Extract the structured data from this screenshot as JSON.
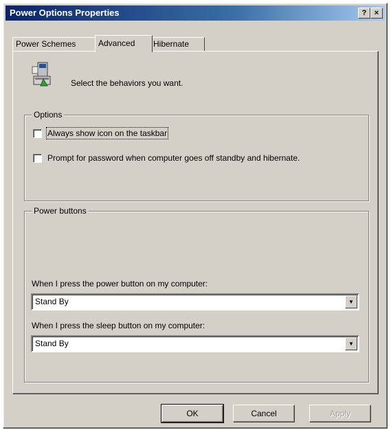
{
  "window": {
    "title": "Power Options Properties",
    "help_button": "?",
    "close_button": "×"
  },
  "tabs": [
    {
      "label": "Power Schemes"
    },
    {
      "label": "Advanced"
    },
    {
      "label": "Hibernate"
    }
  ],
  "intro": {
    "text": "Select the behaviors you want."
  },
  "options": {
    "legend": "Options",
    "checkboxes": [
      {
        "label": "Always show icon on the taskbar",
        "checked": false
      },
      {
        "label": "Prompt for password when computer goes off standby and hibernate.",
        "checked": false
      }
    ]
  },
  "power_buttons": {
    "legend": "Power buttons",
    "power_label": "When I press the power button on my computer:",
    "power_value": "Stand By",
    "sleep_label": "When I press the sleep button on my computer:",
    "sleep_value": "Stand By"
  },
  "buttons": {
    "ok": "OK",
    "cancel": "Cancel",
    "apply": "Apply"
  },
  "icons": {
    "intro_icon": "computer-power-icon",
    "dropdown_arrow": "chevron-down-icon"
  }
}
